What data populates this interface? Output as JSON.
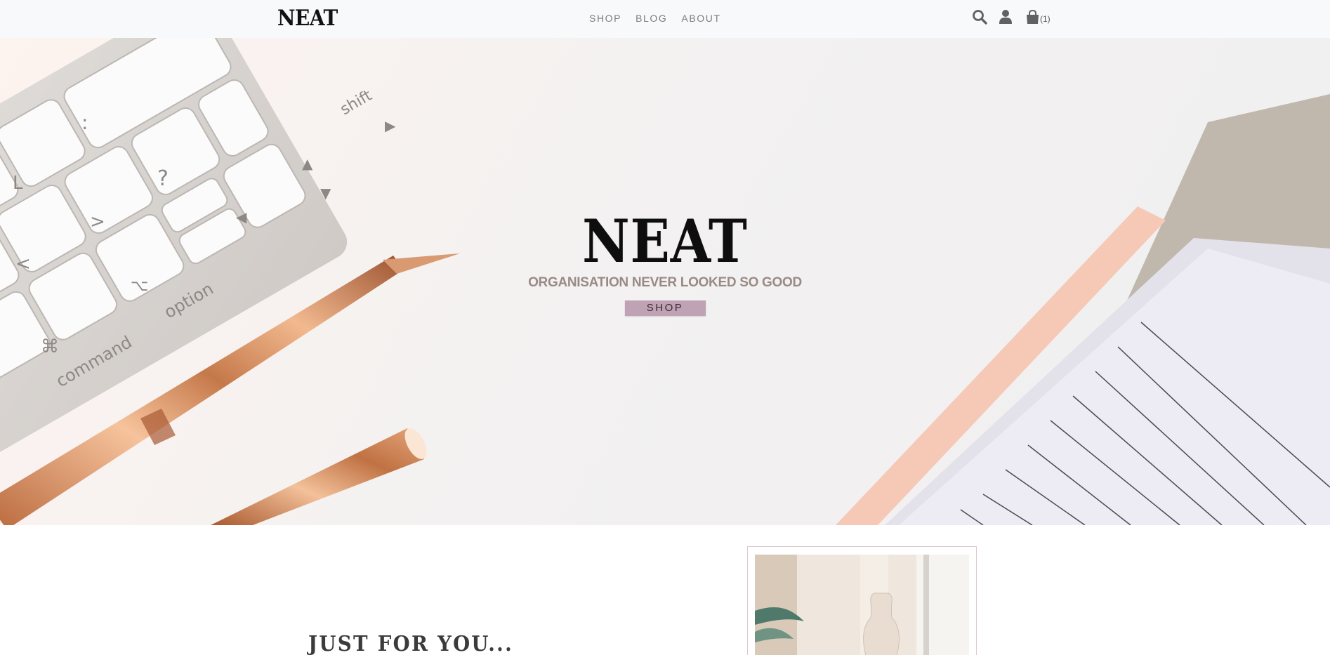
{
  "header": {
    "logo": "NEAT",
    "nav": [
      {
        "label": "SHOP"
      },
      {
        "label": "BLOG"
      },
      {
        "label": "ABOUT"
      }
    ],
    "icons": [
      "search-icon",
      "user-icon",
      "shopping-bag-icon"
    ],
    "cart_count": "(1)"
  },
  "hero": {
    "title": "NEAT",
    "subtitle": "ORGANISATION NEVER LOOKED SO GOOD",
    "button_label": "SHOP"
  },
  "section": {
    "heading": "JUST FOR YOU..."
  },
  "colors": {
    "header_bg": "#f8f9fa",
    "button_bg": "#bfa3b4",
    "subtitle": "#998a86",
    "card_border": "#dcc9cf"
  }
}
